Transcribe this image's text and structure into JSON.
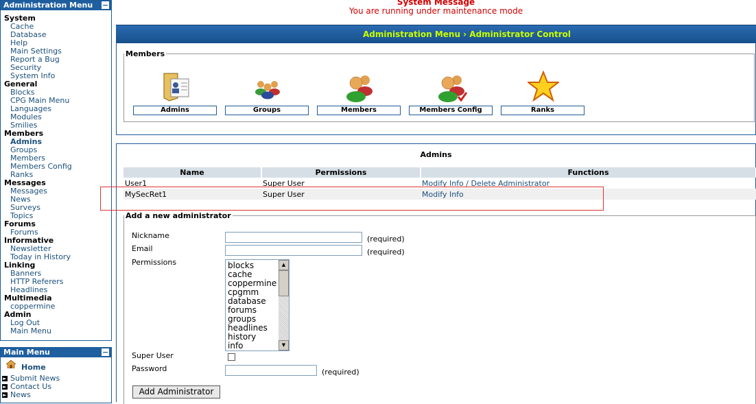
{
  "admin_menu": {
    "title": "Administration Menu",
    "toggle": "−",
    "sections": [
      {
        "label": "System",
        "items": [
          "Cache",
          "Database",
          "Help",
          "Main Settings",
          "Report a Bug",
          "Security",
          "System Info"
        ]
      },
      {
        "label": "General",
        "items": [
          "Blocks",
          "CPG Main Menu",
          "Languages",
          "Modules",
          "Smilies"
        ]
      },
      {
        "label": "Members",
        "items": [
          "Admins",
          "Groups",
          "Members",
          "Members Config",
          "Ranks"
        ]
      },
      {
        "label": "Messages",
        "items": [
          "Messages",
          "News",
          "Surveys",
          "Topics"
        ]
      },
      {
        "label": "Forums",
        "items": [
          "Forums"
        ]
      },
      {
        "label": "Informative",
        "items": [
          "Newsletter",
          "Today in History"
        ]
      },
      {
        "label": "Linking",
        "items": [
          "Banners",
          "HTTP Referers",
          "Headlines"
        ]
      },
      {
        "label": "Multimedia",
        "items": [
          "coppermine"
        ]
      },
      {
        "label": "Admin",
        "items": [
          "Log Out",
          "Main Menu"
        ]
      }
    ],
    "active_item": "Admins"
  },
  "main_menu": {
    "title": "Main Menu",
    "toggle": "−",
    "home": "Home",
    "items": [
      "Submit News",
      "Contact Us",
      "News"
    ]
  },
  "system_message": {
    "title": "System Message",
    "message": "You are running under maintenance mode"
  },
  "breadcrumb": "Administration Menu › Administrator Control",
  "members_panel": {
    "legend": "Members",
    "buttons": [
      {
        "label": "Admins",
        "icon": "admin-badge-icon"
      },
      {
        "label": "Groups",
        "icon": "groups-icon"
      },
      {
        "label": "Members",
        "icon": "members-icon"
      },
      {
        "label": "Members Config",
        "icon": "members-config-icon"
      },
      {
        "label": "Ranks",
        "icon": "star-icon"
      }
    ]
  },
  "admins_table": {
    "title": "Admins",
    "headers": [
      "Name",
      "Permissions",
      "Functions"
    ],
    "rows": [
      {
        "name": "User1",
        "permissions": "Super User",
        "modify": "Modify Info",
        "sep": " / ",
        "delete": "Delete Administrator"
      },
      {
        "name": "MySecRet1",
        "permissions": "Super User",
        "modify": "Modify Info"
      }
    ]
  },
  "add_form": {
    "legend": "Add a new administrator",
    "nickname_label": "Nickname",
    "email_label": "Email",
    "permissions_label": "Permissions",
    "superuser_label": "Super User",
    "password_label": "Password",
    "required": "(required)",
    "permission_options": [
      "blocks",
      "cache",
      "coppermine",
      "cpgmm",
      "database",
      "forums",
      "groups",
      "headlines",
      "history",
      "info"
    ],
    "submit_label": "Add Administrator"
  }
}
